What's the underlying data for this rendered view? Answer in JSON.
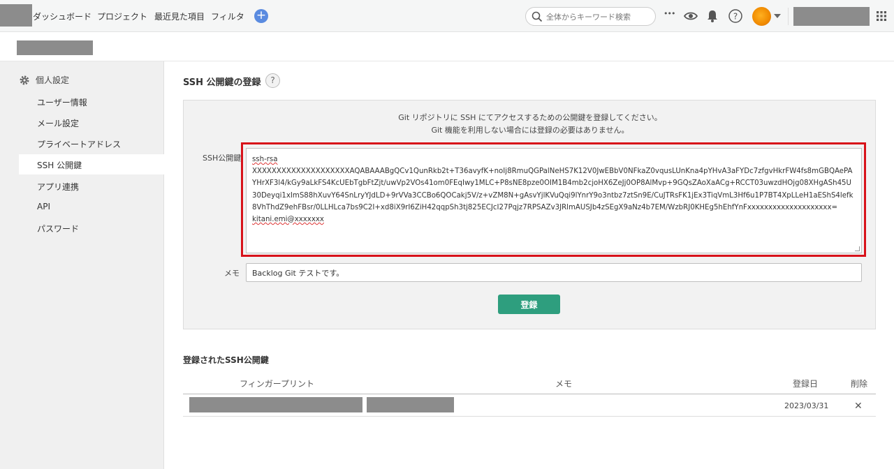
{
  "nav": {
    "links": [
      "ダッシュボード",
      "プロジェクト",
      "最近見た項目",
      "フィルタ"
    ],
    "add_label": "+",
    "search_placeholder": "全体からキーワード検索",
    "more_label": "•••"
  },
  "sidebar": {
    "heading": "個人設定",
    "items": [
      "ユーザー情報",
      "メール設定",
      "プライベートアドレス",
      "SSH 公開鍵",
      "アプリ連携",
      "API",
      "パスワード"
    ],
    "active_index": 3
  },
  "main": {
    "title": "SSH 公開鍵の登録",
    "help_label": "?",
    "info_lines": [
      "Git リポジトリに SSH にてアクセスするための公開鍵を登録してください。",
      "Git 機能を利用しない場合には登録の必要はありません。"
    ],
    "key_label": "SSH公開鍵",
    "key_prefix": "ssh-rsa",
    "key_body": "XXXXXXXXXXXXXXXXXXXXAQABAAABgQCv1QunRkb2t+T36avyfK+noIj8RmuQGPalNeHS7K12V0JwEBbV0NFkaZ0vqusLUnKna4pYHvA3aFYDc7zfgvHkrFW4fs8mGBQAePAYHrXF3l4/kGy9aLkFS4KcUEbTgbFtZjt/uwVp2VOs41om0FEqIwy1MLC+P8sNE8pze0OIM1B4mb2cjoHX6ZeJj0OP8AlMvp+9GQsZAoXaACg+RCCT03uwzdHOjg08XHgASh45U30Deyqi1xImS88hXuvY64SnLryYJdLD+9rVVa3CCBo6QOCakj5V/z+vZM8N+gAsvYjlKVuQqi9lYnrY9o3ntbz7ztSn9E/CuJTRsFK1jEx3TiqVmL3Hf6u1P7BT4XpLLeH1aEShS4lefk8VhThdZ9ehFBsr/0LLHLca7bs9C2I+xd8iX9rI6ZiH42qqpSh3tj825ECJcI27Pqjz7RPSAZv3JRlmAUSJb4zSEgX9aNz4b7EM/WzbRJ0KHEg5hEhfYnFxxxxxxxxxxxxxxxxxxxx=",
    "key_suffix": "kitani.emi@xxxxxxx",
    "memo_label": "メモ",
    "memo_value": "Backlog Git テストです。",
    "submit_label": "登録"
  },
  "registered": {
    "title": "登録されたSSH公開鍵",
    "columns": [
      "フィンガープリント",
      "メモ",
      "登録日",
      "削除"
    ],
    "rows": [
      {
        "date": "2023/03/31",
        "delete_label": "✕"
      }
    ]
  },
  "colors": {
    "accent_green": "#2e9e7e",
    "highlight_red": "#d8121a",
    "plus_blue": "#5a8be0"
  }
}
